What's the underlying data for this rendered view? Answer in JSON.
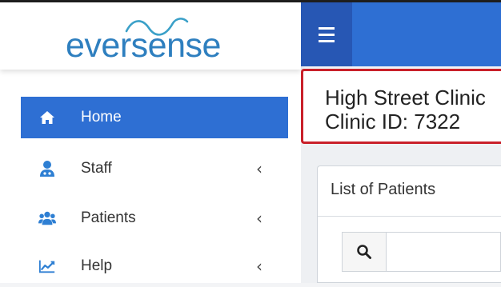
{
  "brand": {
    "logo_text": "eversense",
    "logo_color": "#2e7fbf"
  },
  "colors": {
    "accent": "#2e6fd3",
    "header_dark": "#2757b4",
    "highlight_border": "#c9202a"
  },
  "header": {
    "menu_icon": "hamburger-icon"
  },
  "sidebar": {
    "items": [
      {
        "label": "Home",
        "icon": "home-icon",
        "active": true
      },
      {
        "label": "Staff",
        "icon": "staff-icon",
        "chevron": "‹"
      },
      {
        "label": "Patients",
        "icon": "users-icon",
        "chevron": "‹"
      },
      {
        "label": "Help",
        "icon": "chart-line-icon",
        "chevron": "‹"
      }
    ]
  },
  "clinic": {
    "name": "High Street Clinic",
    "id_text": "Clinic ID: 7322"
  },
  "patients_panel": {
    "title": "List of Patients",
    "search_icon": "search-icon",
    "search_value": ""
  }
}
